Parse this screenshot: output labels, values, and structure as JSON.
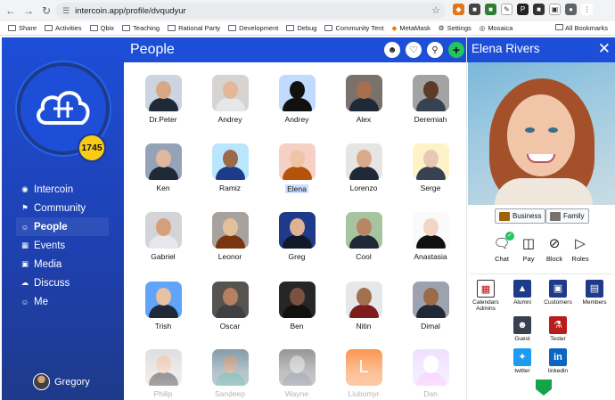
{
  "browser": {
    "url": "intercoin.app/profile/dvqudyur",
    "bookmarks": [
      {
        "label": "Share",
        "icon": "folder-icon"
      },
      {
        "label": "Activities",
        "icon": "folder-icon"
      },
      {
        "label": "Qbix",
        "icon": "folder-icon"
      },
      {
        "label": "Teaching",
        "icon": "folder-icon"
      },
      {
        "label": "Rational Party",
        "icon": "folder-icon"
      },
      {
        "label": "Development",
        "icon": "folder-icon"
      },
      {
        "label": "Debug",
        "icon": "folder-icon"
      },
      {
        "label": "Community Tent",
        "icon": "folder-icon"
      },
      {
        "label": "MetaMask",
        "icon": "metamask-icon"
      },
      {
        "label": "Settings",
        "icon": "gear-icon"
      },
      {
        "label": "Mosaica",
        "icon": "globe-icon"
      }
    ],
    "all_bookmarks": "All Bookmarks"
  },
  "sidebar": {
    "badge_count": "1745",
    "menu": [
      {
        "label": "Intercoin",
        "icon": "eye-icon",
        "active": false
      },
      {
        "label": "Community",
        "icon": "flag-icon",
        "active": false
      },
      {
        "label": "People",
        "icon": "person-icon",
        "active": true
      },
      {
        "label": "Events",
        "icon": "calendar-icon",
        "active": false
      },
      {
        "label": "Media",
        "icon": "media-icon",
        "active": false
      },
      {
        "label": "Discuss",
        "icon": "chat-icon",
        "active": false
      },
      {
        "label": "Me",
        "icon": "person-icon",
        "active": false
      }
    ],
    "user_name": "Gregory"
  },
  "people": {
    "title": "People",
    "list": [
      {
        "name": "Dr.Peter"
      },
      {
        "name": "Andrey"
      },
      {
        "name": "Andrey"
      },
      {
        "name": "Alex"
      },
      {
        "name": "Deremiah"
      },
      {
        "name": "Ken"
      },
      {
        "name": "Ramiz"
      },
      {
        "name": "Elena",
        "selected": true
      },
      {
        "name": "Lorenzo"
      },
      {
        "name": "Serge"
      },
      {
        "name": "Gabriel"
      },
      {
        "name": "Leonor"
      },
      {
        "name": "Greg"
      },
      {
        "name": "Cool"
      },
      {
        "name": "Anastasia"
      },
      {
        "name": "Trish"
      },
      {
        "name": "Oscar"
      },
      {
        "name": "Ben"
      },
      {
        "name": "Nitin"
      },
      {
        "name": "Dimal"
      },
      {
        "name": "Philip"
      },
      {
        "name": "Sandeep"
      },
      {
        "name": "Wayne"
      },
      {
        "name": "Liubomyr"
      },
      {
        "name": "Dan"
      }
    ]
  },
  "profile": {
    "name": "Elena Rivers",
    "tags": [
      "Business",
      "Family"
    ],
    "actions": [
      {
        "label": "Chat",
        "icon": "chat-icon"
      },
      {
        "label": "Pay",
        "icon": "coins-icon"
      },
      {
        "label": "Block",
        "icon": "eye-off-icon"
      },
      {
        "label": "Roles",
        "icon": "tag-icon"
      }
    ],
    "roles": [
      {
        "label": "Calendars Admins",
        "icon": "calendar-icon"
      },
      {
        "label": "Alumni",
        "icon": "graduation-cap-icon"
      },
      {
        "label": "Customers",
        "icon": "cart-icon"
      },
      {
        "label": "Members",
        "icon": "id-card-icon"
      },
      {
        "label": "Guest",
        "icon": "guest-icon"
      },
      {
        "label": "Tester",
        "icon": "flask-icon"
      },
      {
        "label": "twitter",
        "icon": "twitter-icon"
      },
      {
        "label": "linkedin",
        "icon": "linkedin-icon"
      }
    ]
  },
  "colors": {
    "accent": "#1d4ed8",
    "badge": "#facc15",
    "add_button": "#22c55e"
  }
}
